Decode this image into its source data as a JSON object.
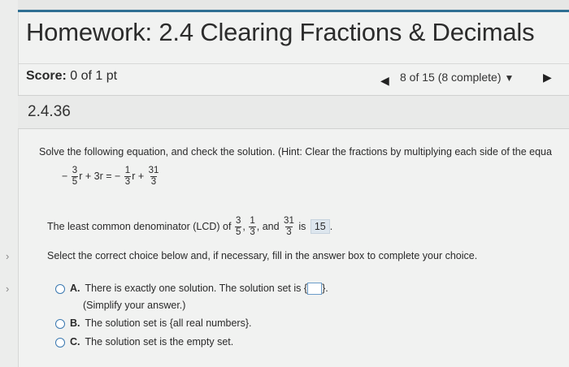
{
  "header": {
    "title": "Homework: 2.4 Clearing Fractions & Decimals"
  },
  "score": {
    "label": "Score:",
    "value": "0 of 1 pt"
  },
  "navigation": {
    "progress_text": "8 of 15 (8 complete)",
    "prev_icon": "triangle-left-icon",
    "next_icon": "triangle-right-icon",
    "dropdown_icon": "caret-down-icon"
  },
  "question": {
    "id": "2.4.36",
    "instruction": "Solve the following equation, and check the solution. (Hint: Clear the fractions by multiplying each side of the equa",
    "equation": {
      "f1_sign": "−",
      "f1_num": "3",
      "f1_den": "5",
      "mid": "r + 3r =",
      "f2_sign": "−",
      "f2_num": "1",
      "f2_den": "3",
      "f2_suffix": "r +",
      "f3_num": "31",
      "f3_den": "3"
    },
    "lcd": {
      "prefix": "The least common denominator (LCD) of",
      "a_num": "3",
      "a_den": "5",
      "comma1": ",",
      "b_num": "1",
      "b_den": "3",
      "and": ", and",
      "c_num": "31",
      "c_den": "3",
      "is": "is",
      "answer": "15",
      "end": "."
    },
    "select_prompt": "Select the correct choice below and, if necessary, fill in the answer box to complete your choice.",
    "choices": [
      {
        "letter": "A.",
        "text": "There is exactly one solution. The solution set is",
        "brace_open": "{",
        "brace_close": "}.",
        "note": "(Simplify your answer.)"
      },
      {
        "letter": "B.",
        "text": "The solution set is {all real numbers}."
      },
      {
        "letter": "C.",
        "text": "The solution set is the empty set."
      }
    ]
  },
  "colors": {
    "accent": "#2f6f93",
    "radio": "#3a78b0",
    "answer_highlight": "#dde6ee"
  }
}
